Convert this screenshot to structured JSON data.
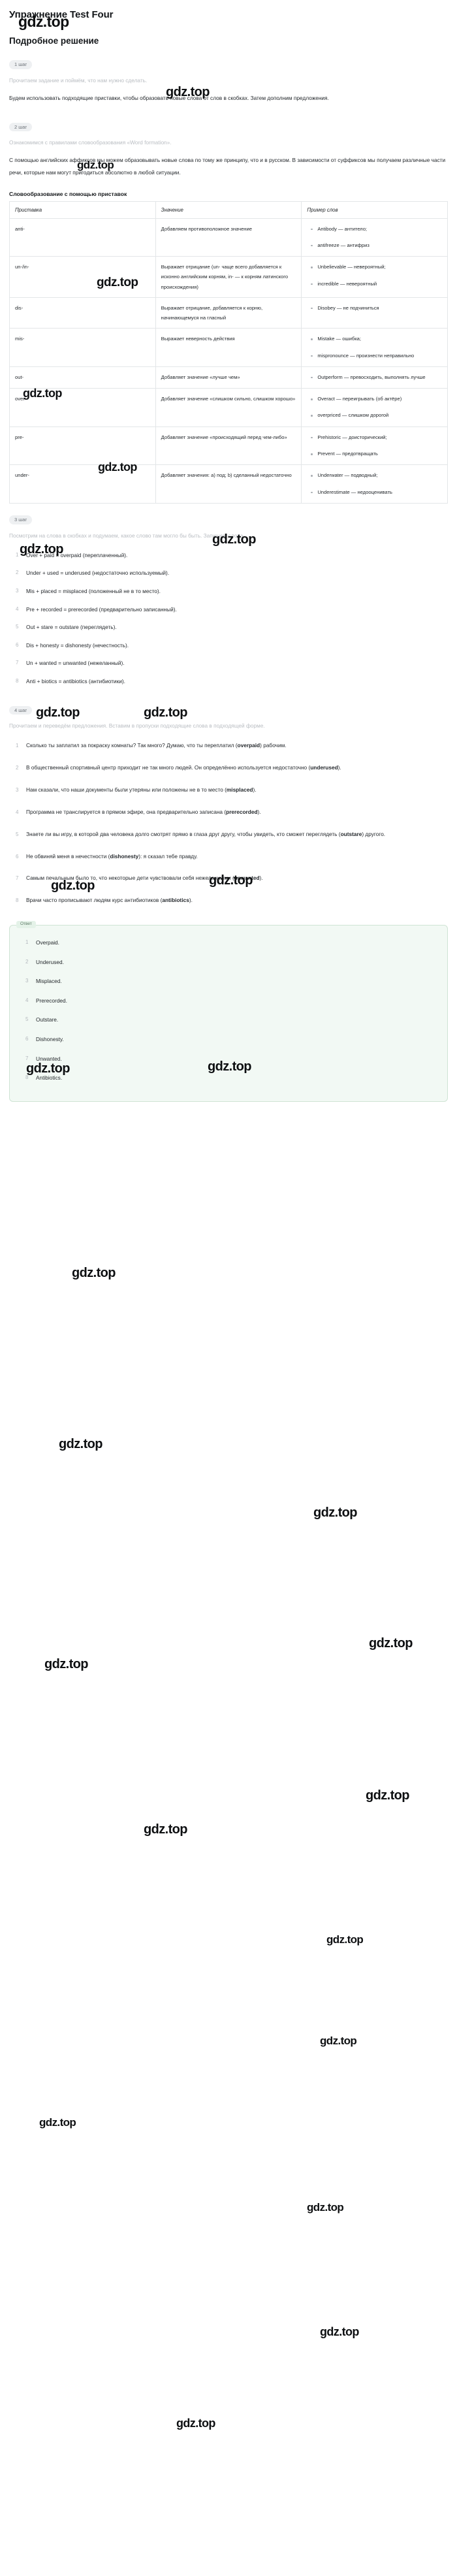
{
  "header": {
    "exercise_title": "Упражнение Test Four",
    "solution_title": "Подробное решение"
  },
  "watermark": {
    "text": "gdz.top"
  },
  "steps": {
    "step1": {
      "badge": "1 шаг",
      "muted": "Прочитаем задание и поймём, что нам нужно сделать.",
      "body": "Будем использовать подходящие приставки, чтобы образовать новые слова от слов в скобках. Затем дополним предложения."
    },
    "step2": {
      "badge": "2 шаг",
      "muted": "Ознакомимся с правилами словообразования «Word formation».",
      "body": "С помощью английских аффиксов мы можем образовывать новые слова по тому же принципу, что и в русском. В зависимости от суффиксов мы получаем различные части речи, которые нам могут пригодиться абсолютно в любой ситуации.",
      "table_heading": "Словообразование с помощью приставок"
    },
    "step3": {
      "badge": "3 шаг",
      "muted": "Посмотрим на слова в скобках и подумаем, какое слово там могло бы быть. Запишем слова."
    },
    "step4": {
      "badge": "4 шаг",
      "muted": "Прочитаем и переведём предложения. Вставим в пропуски подходящие слова в подходящей форме."
    }
  },
  "prefix_table": {
    "columns": [
      "Приставка",
      "Значение",
      "Пример слов"
    ],
    "rows": [
      {
        "prefix": "anti-",
        "meaning": "Добавляем противоположное значение",
        "examples": [
          "Antibody — антитело;",
          "antifreeze — антифриз"
        ]
      },
      {
        "prefix": "un-/in-",
        "meaning": "Выражает отрицание (un- чаще всего добавляется к исконно английским корням, in- — к корням латинского происхождения)",
        "examples": [
          "Unbelievable — невероятный;",
          "incredible — невероятный"
        ]
      },
      {
        "prefix": "dis-",
        "meaning": "Выражает отрицание, добавляется к корню, начинающемуся на гласный",
        "examples": [
          "Disobey — не подчиниться"
        ]
      },
      {
        "prefix": "mis-",
        "meaning": "Выражает неверность действия",
        "examples": [
          "Mistake — ошибка;",
          "mispronounce — произнести неправильно"
        ]
      },
      {
        "prefix": "out-",
        "meaning": "Добавляет значение «лучше чем»",
        "examples": [
          "Outperform — превосходить, выполнять лучше"
        ]
      },
      {
        "prefix": "over-",
        "meaning": "Добавляет значение «слишком сильно, слишком хорошо»",
        "examples": [
          "Overact — переигрывать (об актёре)",
          "overpriced — слишком дорогой"
        ]
      },
      {
        "prefix": "pre-",
        "meaning": "Добавляет значение «происходящий перед чем-либо»",
        "examples": [
          "Prehistoric — доисторический;",
          "Prevent — предотвращать"
        ]
      },
      {
        "prefix": "under-",
        "meaning": "Добавляет значения: a) под; b) сделанный недостаточно",
        "examples": [
          "Underwater — подводный;",
          "Underestimate — недооценивать"
        ]
      }
    ]
  },
  "word_formation_list": [
    "Over + paid = overpaid (переплаченный).",
    "Under + used = underused (недостаточно используемый).",
    "Mis + placed = misplaced (положенный не в то место).",
    "Pre + recorded = prerecorded (предварительно записанный).",
    "Out + stare = outstare (переглядеть).",
    "Dis + honesty = dishonesty (нечестность).",
    "Un + wanted = unwanted (нежеланный).",
    "Anti + biotics = antibiotics (антибиотики)."
  ],
  "sentences": [
    {
      "before": "Сколько ты заплатил за покраску комнаты? Так много? Думаю, что ты переплатил (",
      "bold": "overpaid",
      "after": ") рабочим."
    },
    {
      "before": "В общественный спортивный центр приходит не так много людей. Он определённо используется недостаточно (",
      "bold": "underused",
      "after": ")."
    },
    {
      "before": "Нам сказали, что наши документы были утеряны или положены не в то место (",
      "bold": "misplaced",
      "after": ")."
    },
    {
      "before": "Программа не транслируется в прямом эфире, она предварительно записана (",
      "bold": "prerecorded",
      "after": ")."
    },
    {
      "before": "Знаете ли вы игру, в которой два человека долго смотрят прямо в глаза друг другу, чтобы увидеть, кто сможет переглядеть (",
      "bold": "outstare",
      "after": ") другого."
    },
    {
      "before": "Не обвиняй меня в нечестности (",
      "bold": "dishonesty",
      "after": "): я сказал тебе правду."
    },
    {
      "before": "Самым печальным было то, что некоторые дети чувствовали себя нежеланными (",
      "bold": "unwanted",
      "after": ")."
    },
    {
      "before": "Врачи часто прописывают людям курс антибиотиков (",
      "bold": "antibiotics",
      "after": ")."
    }
  ],
  "answer": {
    "label": "Ответ",
    "items": [
      "Overpaid.",
      "Underused.",
      "Misplaced.",
      "Prerecorded.",
      "Outstare.",
      "Dishonesty.",
      "Unwanted.",
      "Antibiotics."
    ]
  }
}
